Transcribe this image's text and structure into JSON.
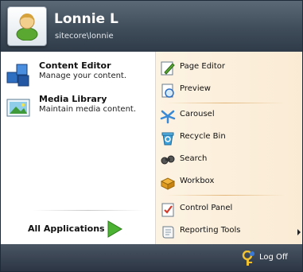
{
  "user": {
    "name": "Lonnie L",
    "account": "sitecore\\lonnie",
    "avatar_icon": "user-icon"
  },
  "left_panel": {
    "apps": [
      {
        "title": "Content Editor",
        "description": "Manage your content.",
        "icon": "content-editor-icon"
      },
      {
        "title": "Media Library",
        "description": "Maintain media content.",
        "icon": "media-library-icon"
      }
    ],
    "all_applications_label": "All Applications"
  },
  "right_panel": {
    "items": [
      {
        "label": "Page Editor",
        "icon": "page-editor-icon"
      },
      {
        "label": "Preview",
        "icon": "preview-icon"
      },
      {
        "label": "Carousel",
        "icon": "carousel-icon"
      },
      {
        "label": "Recycle Bin",
        "icon": "recycle-bin-icon"
      },
      {
        "label": "Search",
        "icon": "search-icon"
      },
      {
        "label": "Workbox",
        "icon": "workbox-icon"
      },
      {
        "label": "Control Panel",
        "icon": "control-panel-icon"
      },
      {
        "label": "Reporting Tools",
        "icon": "reporting-tools-icon",
        "has_submenu": true
      }
    ]
  },
  "footer": {
    "logoff_label": "Log Off",
    "icon": "log-off-icon"
  },
  "colors": {
    "header_dark": "#3f4c5a",
    "right_panel_bg": "#fdf3e3",
    "arrow_green": "#4cb234"
  }
}
